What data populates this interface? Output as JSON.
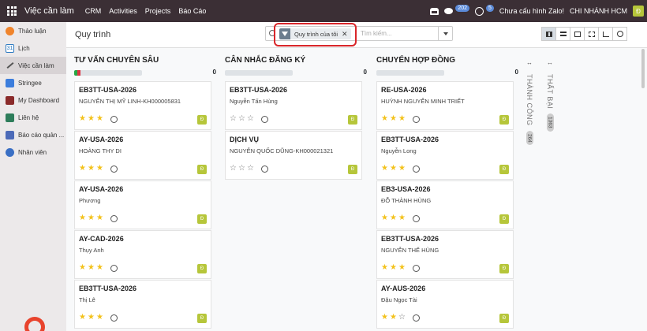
{
  "topbar": {
    "app_name": "Việc cần làm",
    "menu": [
      "CRM",
      "Activities",
      "Projects",
      "Báo Cáo"
    ],
    "chat_count": "202",
    "activity_count": "5",
    "zalo_status": "Chưa cấu hình Zalo!",
    "branch": "CHI NHÁNH HCM",
    "company_initial": "Đ"
  },
  "sidebar": {
    "items": [
      {
        "label": "Thảo luận",
        "icon": "discuss-icon",
        "color": "#f0842c"
      },
      {
        "label": "Lịch",
        "icon": "calendar-icon",
        "color": "#2f7bc1"
      },
      {
        "label": "Việc cần làm",
        "icon": "todo-pen-icon",
        "color": "#555555"
      },
      {
        "label": "Stringee",
        "icon": "stringee-icon",
        "color": "#3c7ddc"
      },
      {
        "label": "My Dashboard",
        "icon": "dashboard-icon",
        "color": "#8a2a2a"
      },
      {
        "label": "Liên hệ",
        "icon": "contacts-icon",
        "color": "#2e7d5b"
      },
      {
        "label": "Báo cáo quản ...",
        "icon": "report-icon",
        "color": "#4c6ab8"
      },
      {
        "label": "Nhân viên",
        "icon": "employees-icon",
        "color": "#3a6fc4"
      }
    ]
  },
  "control": {
    "breadcrumb": "Quy trình",
    "facet_label": "Quy trình của tôi",
    "search_placeholder": "Tìm kiếm..."
  },
  "kanban": {
    "columns": [
      {
        "title": "TƯ VẤN CHUYÊN SÂU",
        "count": "0",
        "cards": [
          {
            "title": "EB3TT-USA-2026",
            "subtitle": "NGUYỄN THỊ MỸ LINH-KH000005831",
            "stars": 3
          },
          {
            "title": "AY-USA-2026",
            "subtitle": "HOÀNG THY DI",
            "stars": 3
          },
          {
            "title": "AY-USA-2026",
            "subtitle": "Phương",
            "stars": 3
          },
          {
            "title": "AY-CAD-2026",
            "subtitle": "Thụy Anh",
            "stars": 3
          },
          {
            "title": "EB3TT-USA-2026",
            "subtitle": "Thị Lê",
            "stars": 3
          }
        ]
      },
      {
        "title": "CÂN NHẮC ĐĂNG KÝ",
        "count": "0",
        "cards": [
          {
            "title": "EB3TT-USA-2026",
            "subtitle": "Nguyễn Tấn Hùng",
            "stars": 0
          },
          {
            "title": "DỊCH VỤ",
            "subtitle": "NGUYỄN QUỐC DŨNG-KH000021321",
            "stars": 0
          }
        ]
      },
      {
        "title": "CHUYỂN HỢP ĐỒNG",
        "count": "0",
        "cards": [
          {
            "title": "RE-USA-2026",
            "subtitle": "HUỲNH NGUYỄN MINH TRIẾT",
            "stars": 3
          },
          {
            "title": "EB3TT-USA-2026",
            "subtitle": "Nguyễn Long",
            "stars": 3
          },
          {
            "title": "EB3-USA-2026",
            "subtitle": "ĐỖ THÀNH HÙNG",
            "stars": 3
          },
          {
            "title": "EB3TT-USA-2026",
            "subtitle": "NGUYỄN THẾ HÙNG",
            "stars": 3
          },
          {
            "title": "AY-AUS-2026",
            "subtitle": "Đậu Ngọc Tài",
            "stars": 2
          }
        ]
      }
    ],
    "folded": [
      {
        "title": "THÀNH CÔNG",
        "count": "264"
      },
      {
        "title": "THẤT BẠI",
        "count": "1363"
      }
    ]
  },
  "colors": {
    "topbar": "#3b2f35",
    "star_on": "#f3c21c",
    "avatar": "#b6c63a",
    "highlight": "#d9262a"
  }
}
